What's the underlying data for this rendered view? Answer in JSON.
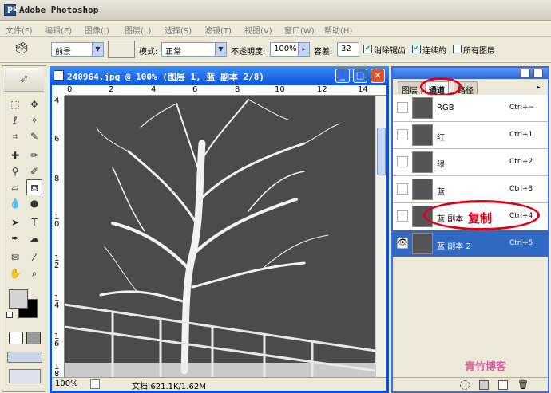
{
  "app": {
    "title": "Adobe Photoshop"
  },
  "menu": [
    "文件(F)",
    "编辑(E)",
    "图像(I)",
    "图层(L)",
    "选择(S)",
    "滤镜(T)",
    "视图(V)",
    "窗口(W)",
    "帮助(H)"
  ],
  "options": {
    "fill_source": "前景",
    "mode_label": "模式:",
    "mode_value": "正常",
    "opacity_label": "不透明度:",
    "opacity_value": "100%",
    "tolerance_label": "容差:",
    "tolerance_value": "32",
    "antialias_label": "消除锯齿",
    "contiguous_label": "连续的",
    "all_layers_label": "所有图层"
  },
  "document": {
    "title": "240964.jpg @ 100% (图层 1, 蓝 副本 2/8)",
    "ruler_h": [
      "0",
      "2",
      "4",
      "6",
      "8",
      "10",
      "12",
      "14"
    ],
    "ruler_v": [
      "4",
      "6",
      "8",
      "1\n0",
      "1\n2",
      "1\n4",
      "1\n6",
      "1\n8"
    ],
    "zoom": "100%",
    "doc_info": "文档:621.1K/1.62M"
  },
  "panel": {
    "tabs": [
      "图层",
      "通道",
      "路径"
    ],
    "channels": [
      {
        "name": "RGB",
        "shortcut": "Ctrl+~"
      },
      {
        "name": "红",
        "shortcut": "Ctrl+1"
      },
      {
        "name": "绿",
        "shortcut": "Ctrl+2"
      },
      {
        "name": "蓝",
        "shortcut": "Ctrl+3"
      },
      {
        "name": "蓝 副本",
        "shortcut": "Ctrl+4"
      },
      {
        "name": "蓝 副本 2",
        "shortcut": "Ctrl+5"
      }
    ],
    "annotation": "复制"
  },
  "watermark": "青竹博客",
  "colors": {
    "accent": "#0a4fd5",
    "selected_row": "#316ac5",
    "annotation": "#e0001a"
  }
}
